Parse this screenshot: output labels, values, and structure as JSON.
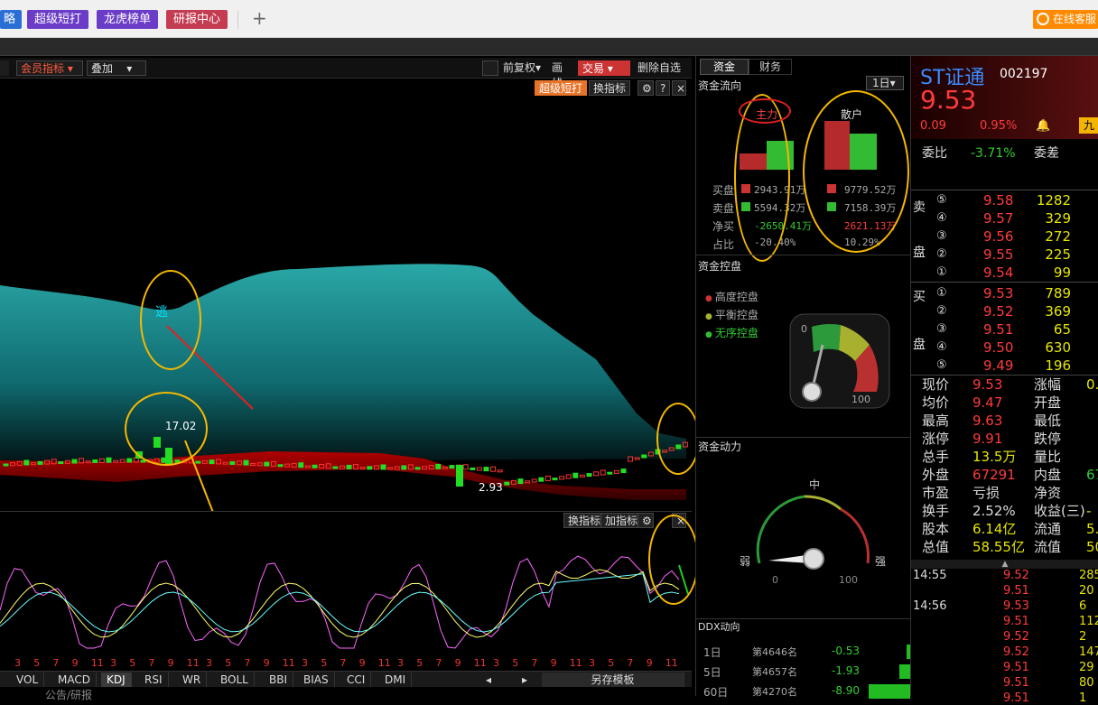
{
  "topbar": {
    "btn0": "略",
    "btn1": "超级短打",
    "btn2": "龙虎榜单",
    "btn3": "研报中心",
    "plus": "+",
    "service": "在线客服"
  },
  "chartbar": {
    "menu1": "会员指标",
    "menu2": "叠加",
    "menu3": "前复权",
    "menu4": "画线",
    "trade": "交易",
    "del": "删除自选",
    "sub1": "超级短打",
    "sub2": "换指标",
    "sub3": "换指标",
    "sub4": "加指标"
  },
  "chart": {
    "label_high": "17.02",
    "label_low": "2.93",
    "tag_escape": "逃"
  },
  "tabs": [
    "VOL",
    "MACD",
    "KDJ",
    "RSI",
    "WR",
    "BOLL",
    "BBI",
    "BIAS",
    "CCI",
    "DMI"
  ],
  "tabs_extra": {
    "save": "另存模板",
    "bottom_text": "公告/研报"
  },
  "xaxis": [
    "3",
    "5",
    "7",
    "9",
    "11",
    "3",
    "5",
    "7",
    "9",
    "11",
    "3",
    "5",
    "7",
    "9",
    "11",
    "3",
    "5",
    "7",
    "9",
    "11",
    "3",
    "5",
    "7",
    "9",
    "11",
    "3",
    "5",
    "7",
    "9",
    "11",
    "3",
    "5",
    "7",
    "9",
    "11"
  ],
  "mid": {
    "tab1": "资金",
    "tab2": "财务",
    "title_flow": "资金流向",
    "period": "1日",
    "zhuli": "主力",
    "sanhu": "散户",
    "rows": [
      {
        "label": "买盘",
        "a": "2943.91万",
        "b": "9779.52万"
      },
      {
        "label": "卖盘",
        "a": "5594.32万",
        "b": "7158.39万"
      },
      {
        "label": "净买",
        "a": "-2650.41万",
        "b": "2621.13万"
      },
      {
        "label": "占比",
        "a": "-20.40%",
        "b": "10.29%"
      }
    ],
    "title_control": "资金控盘",
    "legend": [
      "高度控盘",
      "平衡控盘",
      "无序控盘"
    ],
    "gauge1": {
      "min": "0",
      "max": "100"
    },
    "title_power": "资金动力",
    "gauge2": {
      "top": "中",
      "left": "弱",
      "right": "强",
      "min": "0",
      "max": "100"
    },
    "title_ddx": "DDX动向",
    "ddx": [
      {
        "p": "1日",
        "rank": "第4646名",
        "v": "-0.53"
      },
      {
        "p": "5日",
        "rank": "第4657名",
        "v": "-1.93"
      },
      {
        "p": "60日",
        "rank": "第4270名",
        "v": "-8.90"
      }
    ]
  },
  "quote": {
    "name": "ST证通",
    "code": "002197",
    "price": "9.53",
    "chg": "0.09",
    "pct": "0.95%",
    "btn": "九",
    "weibi_label": "委比",
    "weibi": "-3.71%",
    "weicha_label": "委差",
    "sell_label": [
      "卖",
      "盘"
    ],
    "buy_label": [
      "买",
      "盘"
    ],
    "sells": [
      {
        "n": "⑤",
        "p": "9.58",
        "v": "1282"
      },
      {
        "n": "④",
        "p": "9.57",
        "v": "329"
      },
      {
        "n": "③",
        "p": "9.56",
        "v": "272"
      },
      {
        "n": "②",
        "p": "9.55",
        "v": "225"
      },
      {
        "n": "①",
        "p": "9.54",
        "v": "99"
      }
    ],
    "buys": [
      {
        "n": "①",
        "p": "9.53",
        "v": "789"
      },
      {
        "n": "②",
        "p": "9.52",
        "v": "369"
      },
      {
        "n": "③",
        "p": "9.51",
        "v": "65"
      },
      {
        "n": "④",
        "p": "9.50",
        "v": "630"
      },
      {
        "n": "⑤",
        "p": "9.49",
        "v": "196"
      }
    ],
    "stats": [
      {
        "l": "现价",
        "v": "9.53",
        "l2": "涨幅",
        "v2": "0."
      },
      {
        "l": "均价",
        "v": "9.47",
        "l2": "开盘",
        "v2": ""
      },
      {
        "l": "最高",
        "v": "9.63",
        "l2": "最低",
        "v2": ""
      },
      {
        "l": "涨停",
        "v": "9.91",
        "l2": "跌停",
        "v2": ""
      },
      {
        "l": "总手",
        "v": "13.5万",
        "l2": "量比",
        "v2": ""
      },
      {
        "l": "外盘",
        "v": "67291",
        "l2": "内盘",
        "v2": "67"
      },
      {
        "l": "市盈",
        "v": "亏损",
        "l2": "净资",
        "v2": ""
      },
      {
        "l": "换手",
        "v": "2.52%",
        "l2": "收益(三)",
        "v2": "-"
      },
      {
        "l": "股本",
        "v": "6.14亿",
        "l2": "流通",
        "v2": "5."
      },
      {
        "l": "总值",
        "v": "58.55亿",
        "l2": "流值",
        "v2": "50."
      }
    ],
    "ticks": [
      {
        "t": "14:55",
        "p": "9.52",
        "v": "285"
      },
      {
        "t": "",
        "p": "9.51",
        "v": "20"
      },
      {
        "t": "14:56",
        "p": "9.53",
        "v": "6"
      },
      {
        "t": "",
        "p": "9.51",
        "v": "112"
      },
      {
        "t": "",
        "p": "9.52",
        "v": "2"
      },
      {
        "t": "",
        "p": "9.52",
        "v": "147"
      },
      {
        "t": "",
        "p": "9.51",
        "v": "29"
      },
      {
        "t": "",
        "p": "9.51",
        "v": "80"
      },
      {
        "t": "",
        "p": "9.51",
        "v": "1"
      }
    ]
  }
}
